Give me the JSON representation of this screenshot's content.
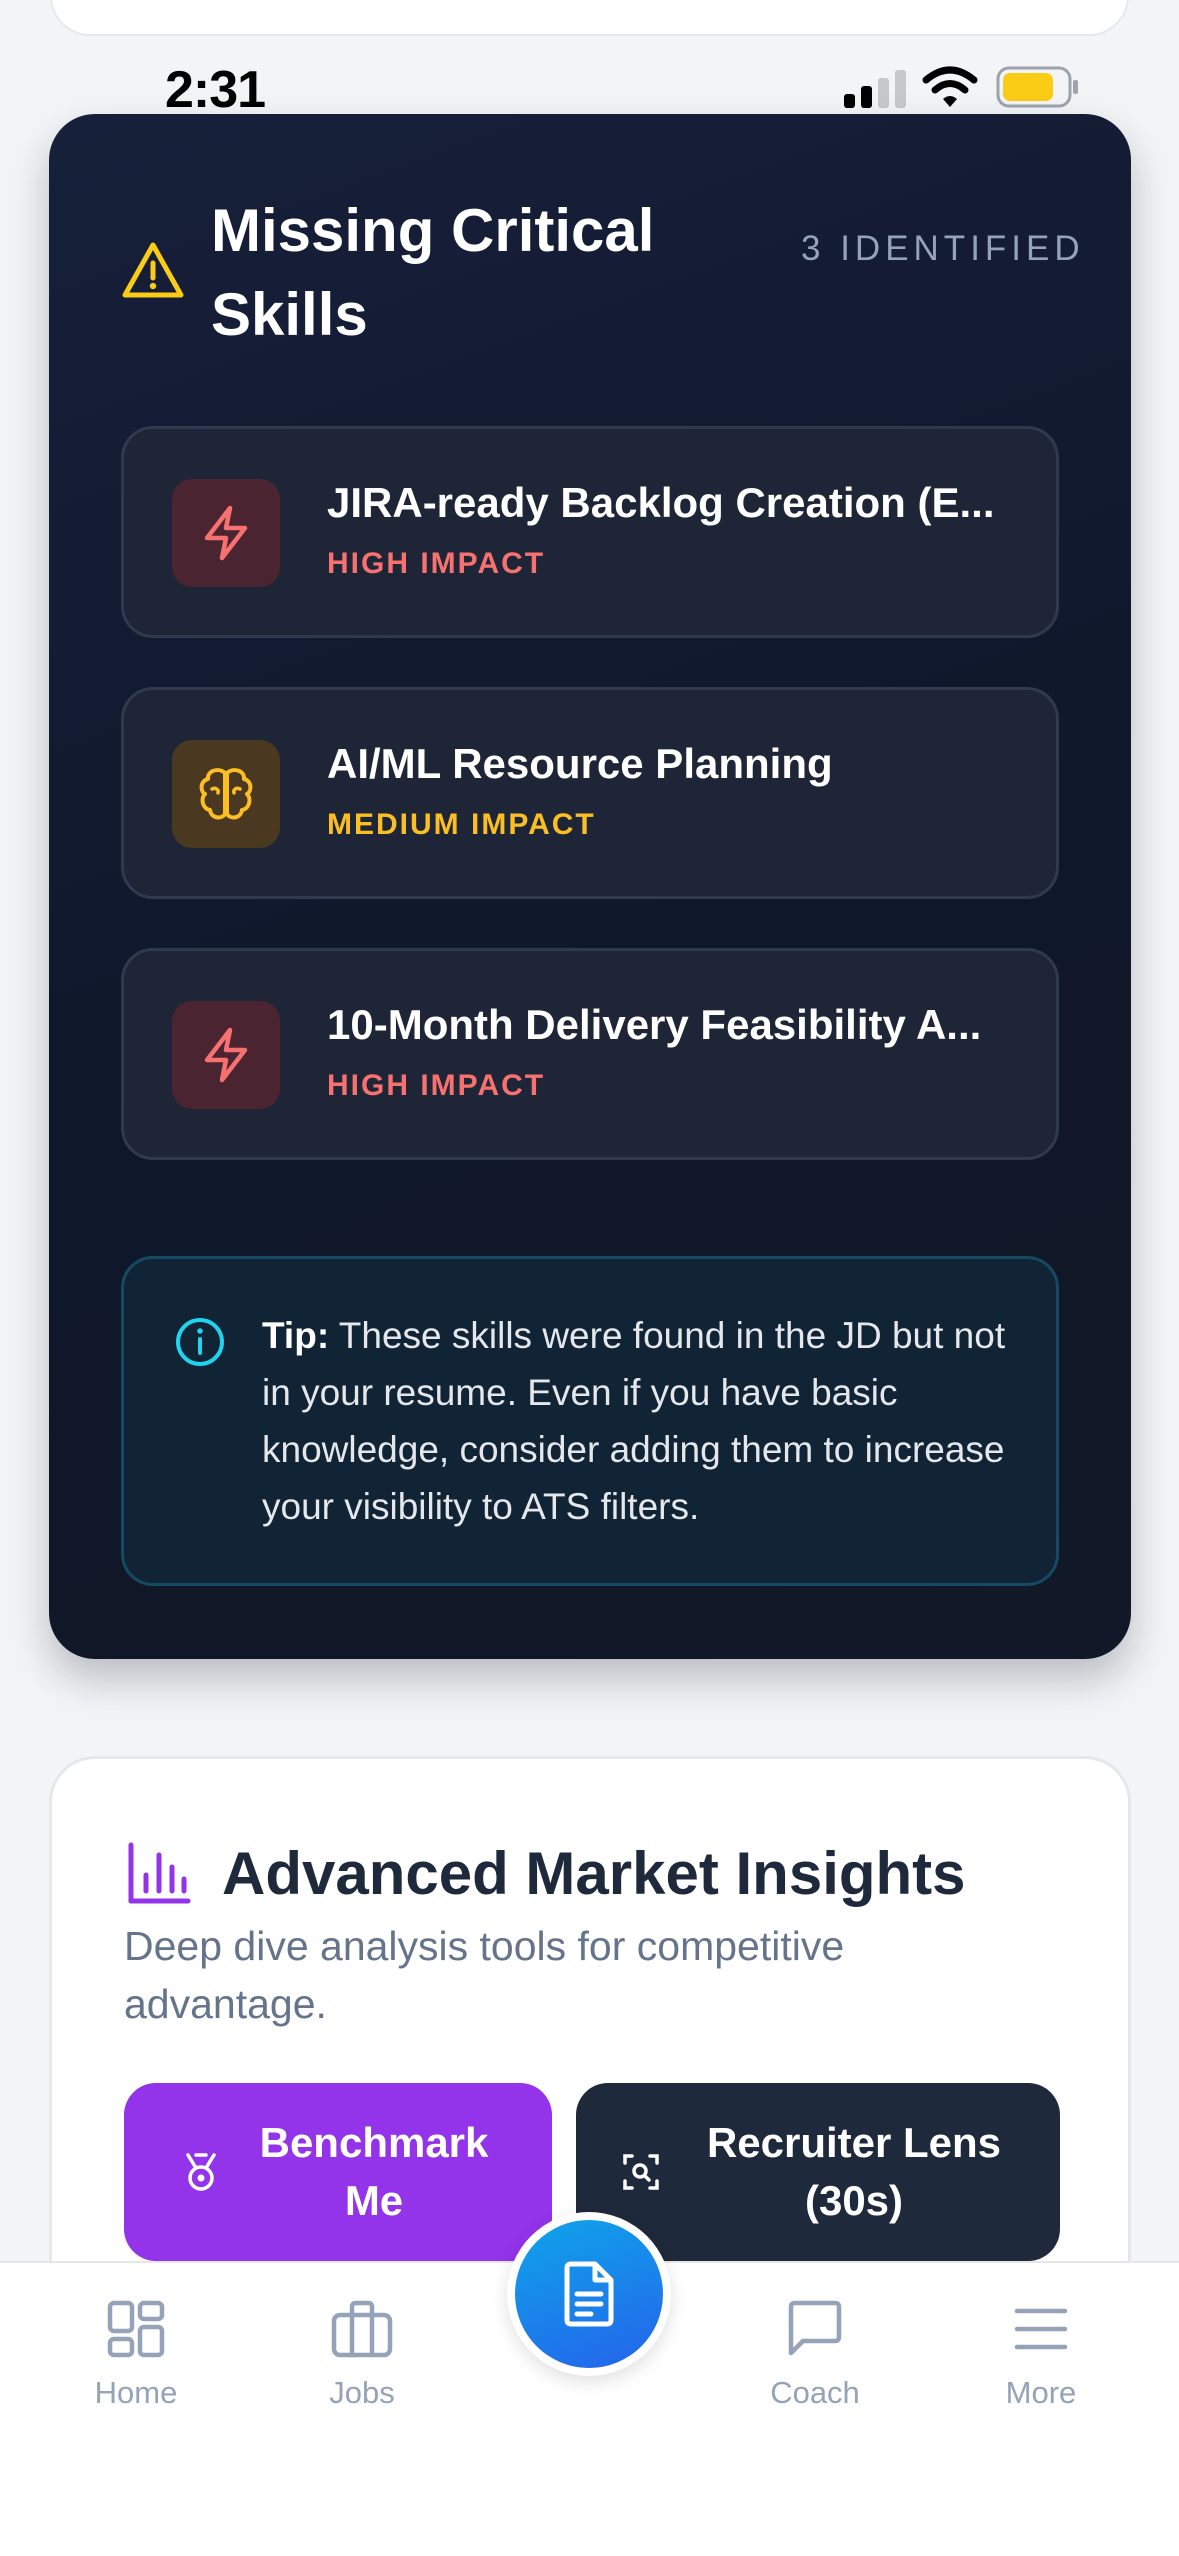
{
  "status_bar": {
    "time": "2:31"
  },
  "skills_card": {
    "title": "Missing Critical Skills",
    "count_label": "3 IDENTIFIED",
    "items": [
      {
        "name": "JIRA-ready Backlog Creation (E...",
        "impact": "HIGH IMPACT",
        "icon": "lightning-icon",
        "level": "high"
      },
      {
        "name": "AI/ML Resource Planning",
        "impact": "MEDIUM IMPACT",
        "icon": "brain-icon",
        "level": "medium"
      },
      {
        "name": "10-Month Delivery Feasibility A...",
        "impact": "HIGH IMPACT",
        "icon": "lightning-icon",
        "level": "high"
      }
    ],
    "tip": {
      "label": "Tip:",
      "text": "These skills were found in the JD but not in your resume. Even if you have basic knowledge, consider adding them to increase your visibility to ATS filters."
    }
  },
  "insights_card": {
    "title": "Advanced Market Insights",
    "subtitle": "Deep dive analysis tools for competitive advantage.",
    "buttons": {
      "benchmark": "Benchmark Me",
      "recruiter": "Recruiter Lens (30s)"
    }
  },
  "bottom_nav": {
    "items": [
      {
        "label": "Home",
        "icon": "grid-icon"
      },
      {
        "label": "Jobs",
        "icon": "briefcase-icon"
      },
      {
        "label": "Coach",
        "icon": "chat-icon"
      },
      {
        "label": "More",
        "icon": "menu-icon"
      }
    ],
    "fab_icon": "document-icon"
  },
  "colors": {
    "card_dark": "#0f172a",
    "high_impact": "#f87171",
    "medium_impact": "#fbbf24",
    "tip_accent": "#22d3ee",
    "benchmark_purple": "#9333ea",
    "fab_blue": "#2563eb",
    "battery_yellow": "#facc15"
  }
}
